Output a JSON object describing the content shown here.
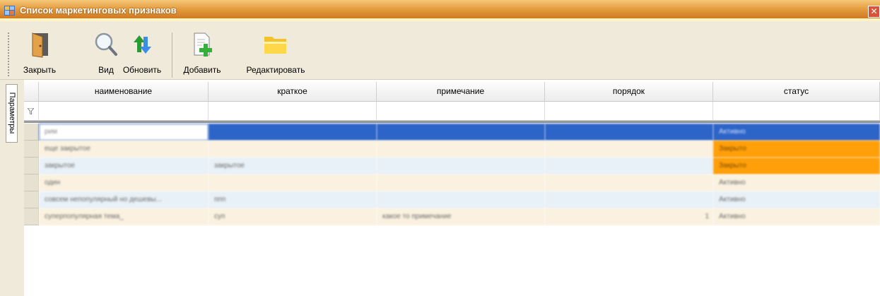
{
  "window": {
    "title": "Список маркетинговых признаков",
    "close_glyph": "✕"
  },
  "toolbar": {
    "buttons": [
      {
        "id": "close",
        "label": "Закрыть",
        "icon": "door-exit-icon"
      },
      {
        "id": "view",
        "label": "Вид",
        "icon": "magnifier-icon"
      },
      {
        "id": "refresh",
        "label": "Обновить",
        "icon": "refresh-arrows-icon"
      },
      {
        "id": "add",
        "label": "Добавить",
        "icon": "document-add-icon"
      },
      {
        "id": "edit",
        "label": "Редактировать",
        "icon": "folder-edit-icon"
      }
    ]
  },
  "sidebar": {
    "tab_label": "Параметры"
  },
  "grid": {
    "columns": [
      "наименование",
      "краткое",
      "примечание",
      "порядок",
      "статус"
    ],
    "filter_icon": "funnel-icon",
    "rows": [
      {
        "name": "рим",
        "short": "",
        "note": "",
        "order": "",
        "status": "Активно",
        "selected": true
      },
      {
        "name": "еще закрытое",
        "short": "",
        "note": "",
        "order": "",
        "status": "Закрыто"
      },
      {
        "name": "закрытое",
        "short": "закрытое",
        "note": "",
        "order": "",
        "status": "Закрыто"
      },
      {
        "name": "один",
        "short": "",
        "note": "",
        "order": "",
        "status": "Активно"
      },
      {
        "name": "совсем непопулярный но дешевы...",
        "short": "ппп",
        "note": "",
        "order": "",
        "status": "Активно"
      },
      {
        "name": "суперпопулярная тема_",
        "short": "суп",
        "note": "какое то примечание",
        "order": "1",
        "status": "Активно"
      }
    ],
    "colors": {
      "selected": "#2d64c7",
      "closed": "#ff9f0a",
      "row_even": "#e8f1f7",
      "row_odd": "#faf1e0"
    }
  }
}
